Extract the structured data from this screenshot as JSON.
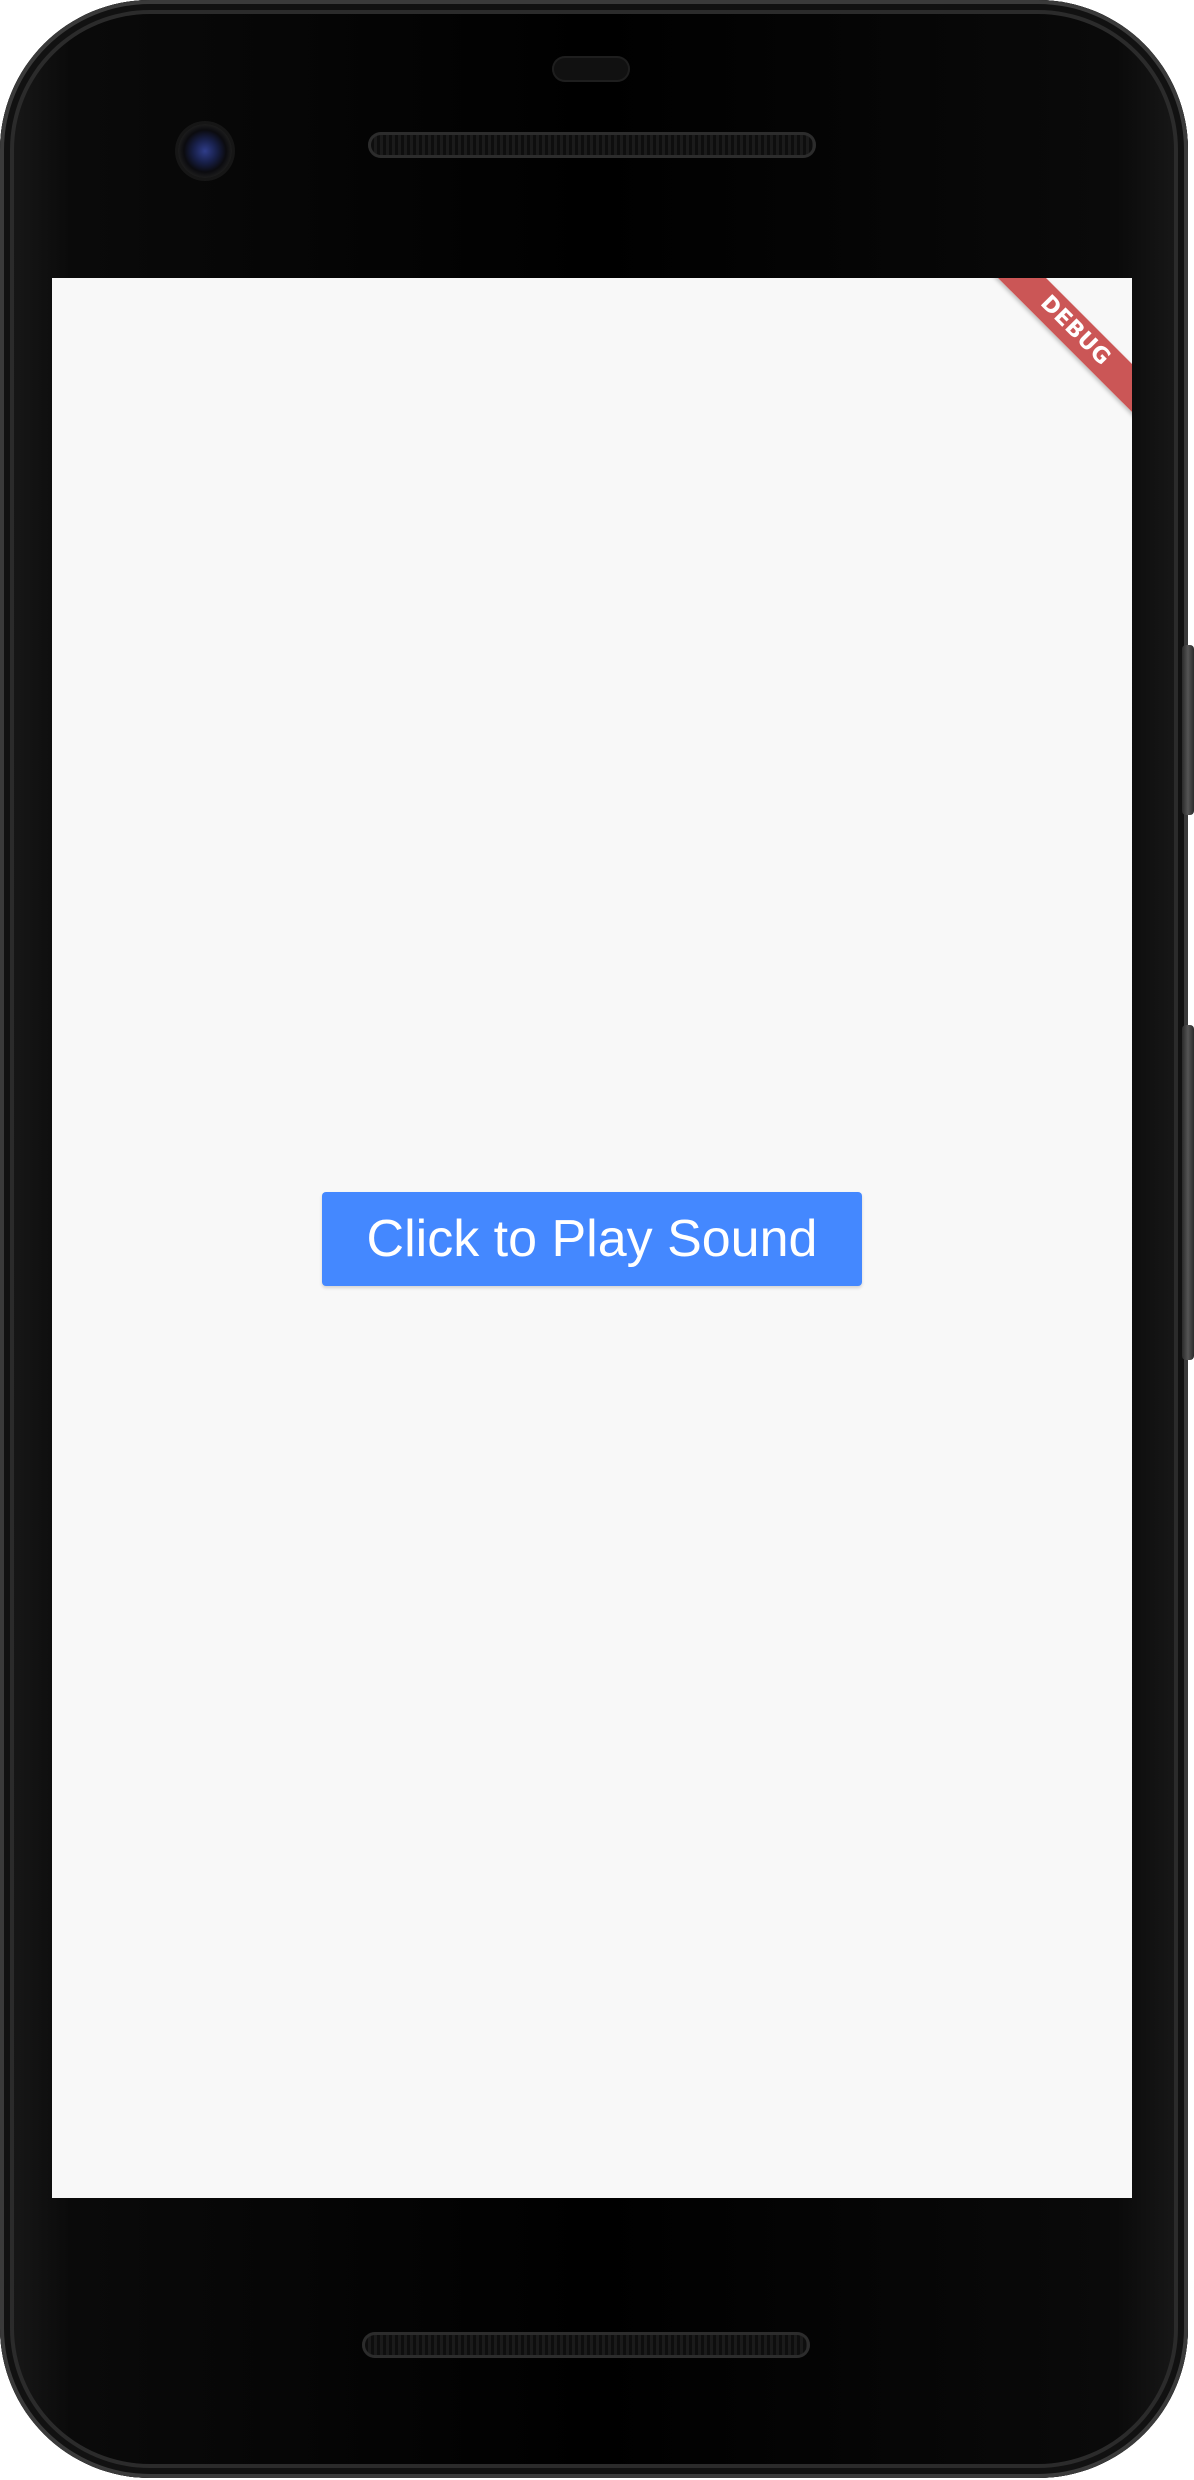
{
  "device": {
    "screen_background": "#f8f8f8"
  },
  "debug_banner": {
    "label": "DEBUG",
    "color": "#be2828"
  },
  "main": {
    "play_button_label": "Click to Play Sound",
    "play_button_color": "#4488ff"
  }
}
